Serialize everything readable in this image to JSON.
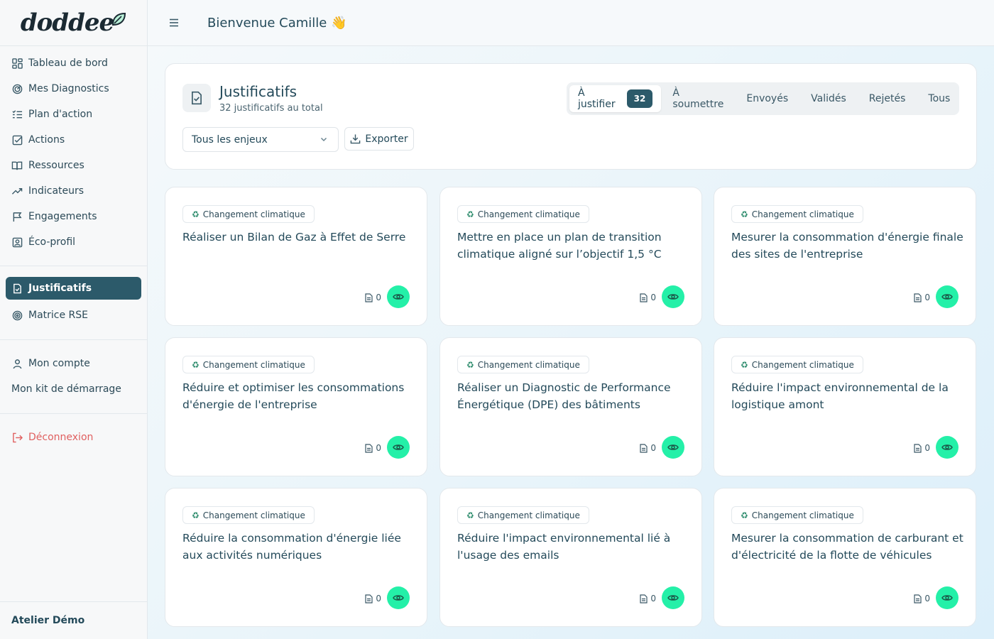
{
  "brand": {
    "name": "doddee"
  },
  "sidebar": {
    "items": [
      {
        "label": "Tableau de bord",
        "icon": "dashboard-icon"
      },
      {
        "label": "Mes Diagnostics",
        "icon": "radar-icon"
      },
      {
        "label": "Plan d'action",
        "icon": "list-icon"
      },
      {
        "label": "Actions",
        "icon": "checkbox-icon"
      },
      {
        "label": "Ressources",
        "icon": "book-icon"
      },
      {
        "label": "Indicateurs",
        "icon": "trend-icon"
      },
      {
        "label": "Engagements",
        "icon": "flag-icon"
      },
      {
        "label": "Éco-profil",
        "icon": "profile-icon"
      }
    ],
    "justificatifs": "Justificatifs",
    "matrice": "Matrice RSE",
    "account": "Mon compte",
    "kit": "Mon kit de démarrage",
    "logout": "Déconnexion",
    "footer": "Atelier Démo"
  },
  "header": {
    "welcome": "Bienvenue Camille 👋"
  },
  "panel": {
    "title": "Justificatifs",
    "subtitle": "32 justificatifs au total",
    "filter": "Tous les enjeux",
    "export": "Exporter",
    "tabs": [
      {
        "label": "À justifier",
        "count": "32"
      },
      {
        "label": "À soumettre"
      },
      {
        "label": "Envoyés"
      },
      {
        "label": "Validés"
      },
      {
        "label": "Rejetés"
      },
      {
        "label": "Tous"
      }
    ]
  },
  "cards": [
    {
      "badge": "Changement climatique",
      "title": "Réaliser un Bilan de Gaz à Effet de Serre",
      "docs": "0"
    },
    {
      "badge": "Changement climatique",
      "title": "Mettre en place un plan de transition climatique aligné sur l’objectif 1,5 °C",
      "docs": "0"
    },
    {
      "badge": "Changement climatique",
      "title": "Mesurer la consommation d'énergie finale des sites de l'entreprise",
      "docs": "0"
    },
    {
      "badge": "Changement climatique",
      "title": "Réduire et optimiser les consommations d'énergie de l'entreprise",
      "docs": "0"
    },
    {
      "badge": "Changement climatique",
      "title": "Réaliser un Diagnostic de Performance Énergétique (DPE) des bâtiments",
      "docs": "0"
    },
    {
      "badge": "Changement climatique",
      "title": "Réduire l'impact environnemental de la logistique amont",
      "docs": "0"
    },
    {
      "badge": "Changement climatique",
      "title": "Réduire la consommation d'énergie liée aux activités numériques",
      "docs": "0"
    },
    {
      "badge": "Changement climatique",
      "title": "Réduire l'impact environnemental lié à l'usage des emails",
      "docs": "0"
    },
    {
      "badge": "Changement climatique",
      "title": "Mesurer la consommation de carburant et d'électricité de la flotte de véhicules",
      "docs": "0"
    }
  ],
  "colors": {
    "accent": "#2c5a6a",
    "eye": "#24f0a8",
    "logout": "#e06060"
  }
}
